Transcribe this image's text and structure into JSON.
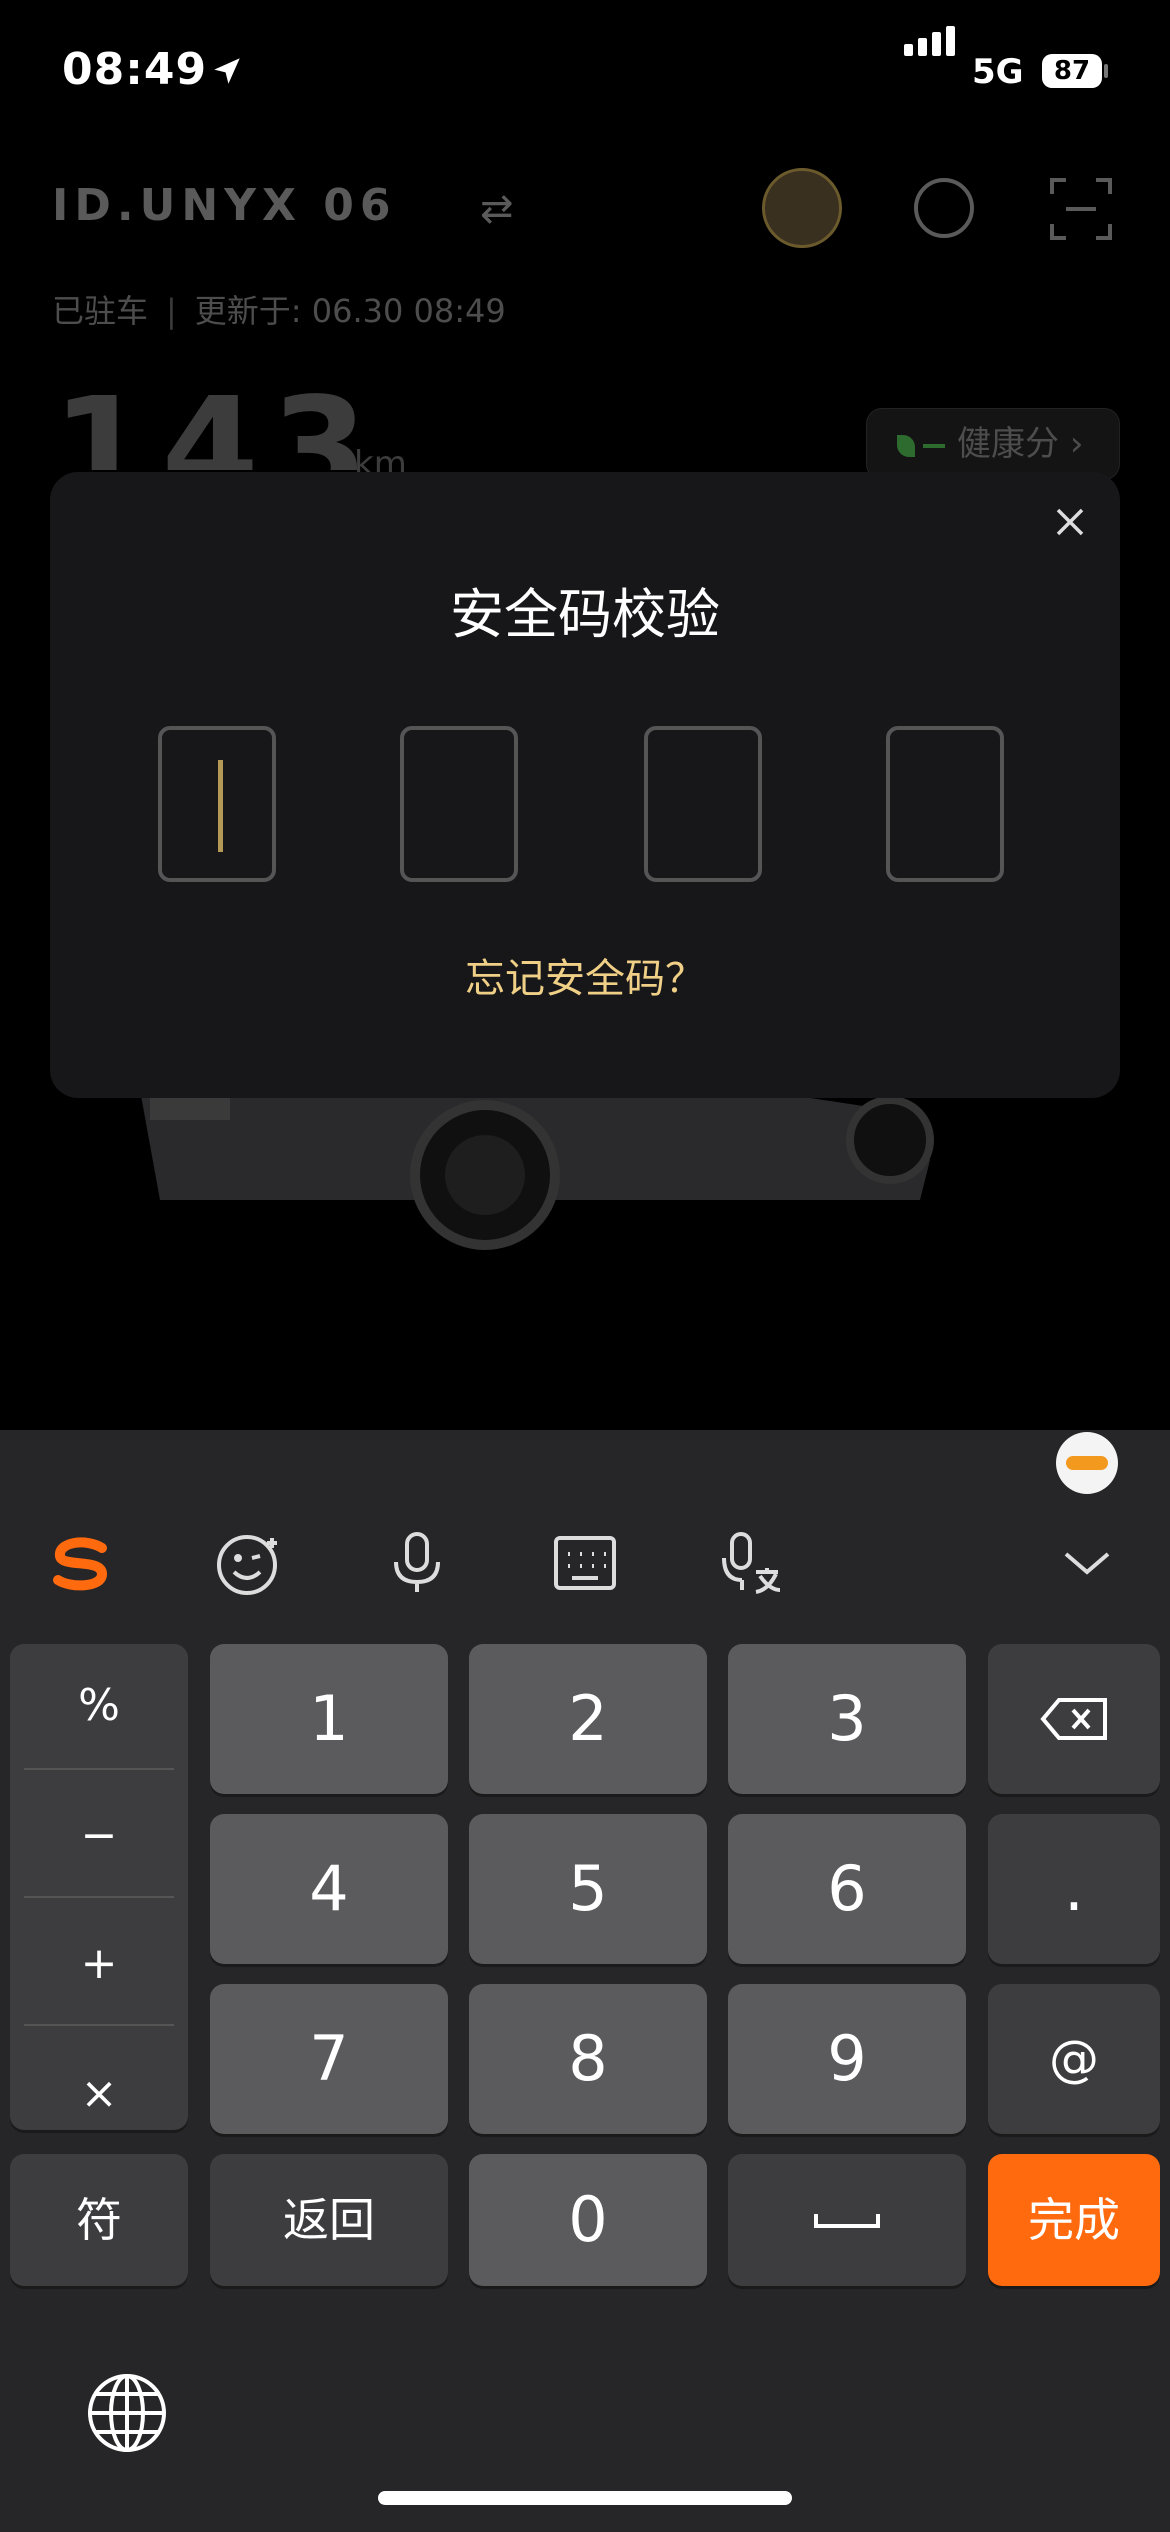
{
  "status_bar": {
    "time": "08:49",
    "network": "5G",
    "battery": "87"
  },
  "header": {
    "brand": "ID.UNYX 06",
    "switch_symbol": "⇄",
    "status": "已驻车",
    "updated": "更新于: 06.30 08:49",
    "range_value": "143",
    "range_unit": "km",
    "health_label": "健康分",
    "health_chevron": "›"
  },
  "modal": {
    "title": "安全码校验",
    "forgot_link": "忘记安全码？",
    "close_icon": "close-icon",
    "code_length": 4
  },
  "keyboard": {
    "toolbar_icons": [
      "sogou-logo-icon",
      "emoji-icon",
      "microphone-icon",
      "keyboard-icon",
      "voice-translate-icon",
      "chevron-down-icon"
    ],
    "symbols": [
      "%",
      "−",
      "+",
      "×"
    ],
    "keys": {
      "k1": "1",
      "k2": "2",
      "k3": "3",
      "k4": "4",
      "k5": "5",
      "k6": "6",
      "k7": "7",
      "k8": "8",
      "k9": "9",
      "k0": "0",
      "dot": ".",
      "at": "@",
      "fu": "符",
      "back": "返回",
      "done": "完成"
    },
    "accent_color": "#ff6a0e"
  }
}
